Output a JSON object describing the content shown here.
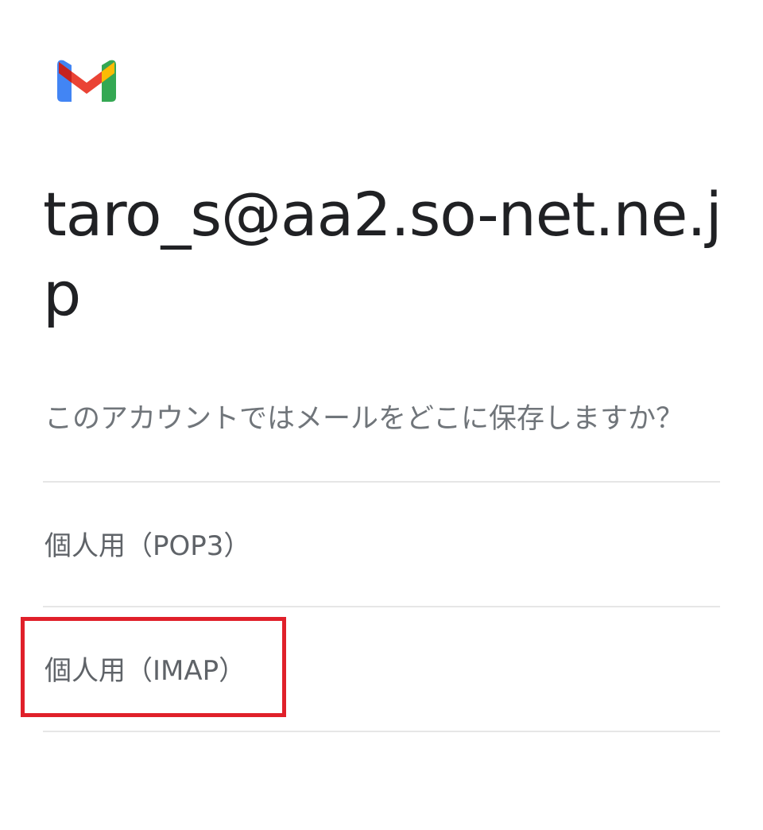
{
  "app": {
    "logo_icon": "gmail-logo-icon"
  },
  "account": {
    "email": "taro_s@aa2.so-net.ne.jp"
  },
  "prompt": {
    "question": "このアカウントではメールをどこに保存しますか？"
  },
  "options": [
    {
      "label": "個人用（POP3）"
    },
    {
      "label": "個人用（IMAP）",
      "highlighted": true
    }
  ],
  "colors": {
    "highlight_border": "#e0202a",
    "title_text": "#202124",
    "secondary_text": "#70757a",
    "divider": "#e6e6e6"
  }
}
